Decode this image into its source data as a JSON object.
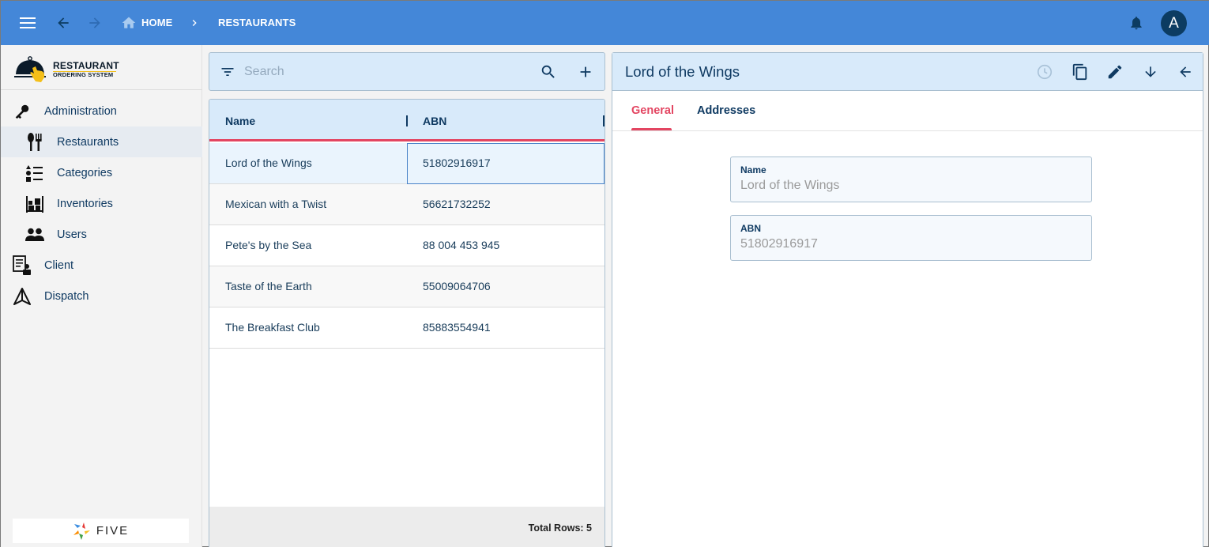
{
  "topbar": {
    "breadcrumb": [
      {
        "label": "HOME",
        "icon": "home-icon"
      },
      {
        "label": "RESTAURANTS"
      }
    ],
    "avatar_initial": "A",
    "colors": {
      "bar": "#4487d8",
      "avatar": "#0c3c62"
    }
  },
  "sidebar": {
    "logo": {
      "title": "RESTAURANT",
      "subtitle": "ORDERING SYSTEM"
    },
    "items": [
      {
        "label": "Administration",
        "icon": "key-icon",
        "level": 0
      },
      {
        "label": "Restaurants",
        "icon": "utensils-icon",
        "level": 1,
        "active": true
      },
      {
        "label": "Categories",
        "icon": "list-icon",
        "level": 1
      },
      {
        "label": "Inventories",
        "icon": "warehouse-icon",
        "level": 1
      },
      {
        "label": "Users",
        "icon": "users-icon",
        "level": 1
      },
      {
        "label": "Client",
        "icon": "client-icon",
        "level": 0
      },
      {
        "label": "Dispatch",
        "icon": "dispatch-icon",
        "level": 0
      }
    ],
    "footer_brand": "FIVE"
  },
  "list": {
    "search": {
      "placeholder": "Search",
      "value": ""
    },
    "columns": [
      "Name",
      "ABN"
    ],
    "rows": [
      {
        "name": "Lord of the Wings",
        "abn": "51802916917",
        "selected": true
      },
      {
        "name": "Mexican with a Twist",
        "abn": "56621732252"
      },
      {
        "name": "Pete's by the Sea",
        "abn": "88 004 453 945"
      },
      {
        "name": "Taste of the Earth",
        "abn": "55009064706"
      },
      {
        "name": "The Breakfast Club",
        "abn": "85883554941"
      }
    ],
    "footer": "Total Rows: 5"
  },
  "detail": {
    "title": "Lord of the Wings",
    "tabs": [
      {
        "label": "General",
        "active": true
      },
      {
        "label": "Addresses"
      }
    ],
    "fields": [
      {
        "label": "Name",
        "value": "Lord of the Wings"
      },
      {
        "label": "ABN",
        "value": "51802916917"
      }
    ],
    "accent": "#e34561"
  }
}
